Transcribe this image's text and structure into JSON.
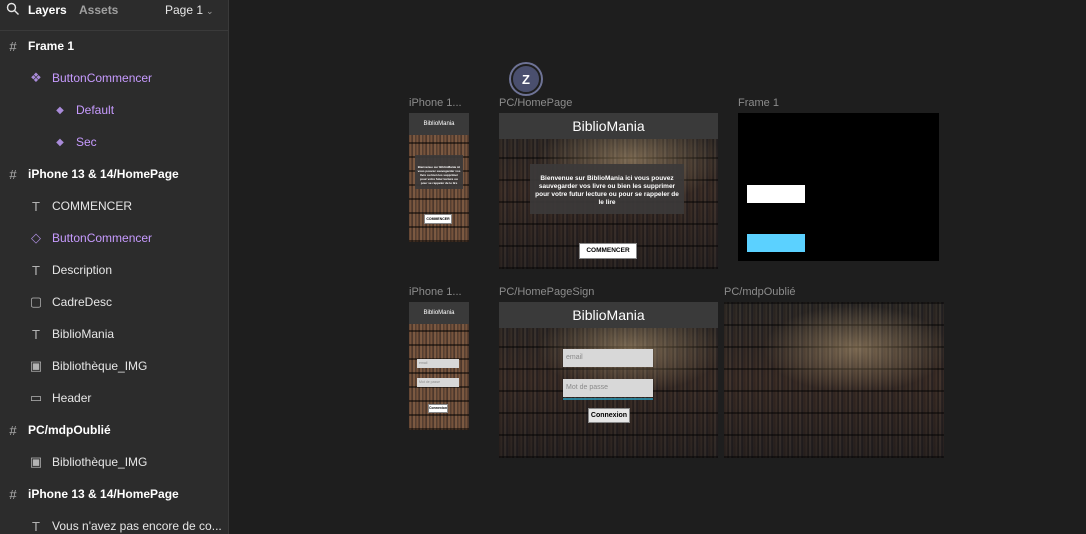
{
  "sidebar": {
    "tabs": {
      "layers": "Layers",
      "assets": "Assets"
    },
    "page": "Page 1",
    "layers": [
      {
        "label": "Frame 1",
        "icon": "frame-icon",
        "kind": "frame"
      },
      {
        "label": "ButtonCommencer",
        "icon": "component-icon",
        "kind": "purple"
      },
      {
        "label": "Default",
        "icon": "variant-icon",
        "kind": "purple"
      },
      {
        "label": "Sec",
        "icon": "variant-icon",
        "kind": "purple"
      },
      {
        "label": "iPhone 13 & 14/HomePage",
        "icon": "frame-icon",
        "kind": "frame"
      },
      {
        "label": "COMMENCER",
        "icon": "text-icon",
        "kind": "plain"
      },
      {
        "label": "ButtonCommencer",
        "icon": "instance-icon",
        "kind": "purple"
      },
      {
        "label": "Description",
        "icon": "text-icon",
        "kind": "plain"
      },
      {
        "label": "CadreDesc",
        "icon": "rectangle-icon",
        "kind": "plain"
      },
      {
        "label": "BiblioMania",
        "icon": "text-icon",
        "kind": "plain"
      },
      {
        "label": "Bibliothèque_IMG",
        "icon": "image-icon",
        "kind": "plain"
      },
      {
        "label": "Header",
        "icon": "header-rect-icon",
        "kind": "plain"
      },
      {
        "label": "PC/mdpOublié",
        "icon": "frame-icon",
        "kind": "frame"
      },
      {
        "label": "Bibliothèque_IMG",
        "icon": "image-icon",
        "kind": "plain"
      },
      {
        "label": "iPhone 13 & 14/HomePage",
        "icon": "frame-icon",
        "kind": "frame"
      },
      {
        "label": "Vous n'avez pas encore de co...",
        "icon": "text-icon",
        "kind": "plain"
      }
    ]
  },
  "canvas": {
    "avatar_letter": "Z",
    "frames": {
      "iphone_home": {
        "label": "iPhone 1...",
        "title": "BiblioMania",
        "desc": "Bienvenue sur BiblioMania ici vous pouvez sauvegarder vos livre ou bien les supprimer pour votre futur lecture ou pour se rappeler de le lire",
        "button": "COMMENCER"
      },
      "pc_home": {
        "label": "PC/HomePage",
        "title": "BiblioMania",
        "desc": "Bienvenue sur BiblioMania ici vous pouvez sauvegarder vos livre ou bien les supprimer pour votre futur lecture ou pour se rappeler de le lire",
        "button": "COMMENCER"
      },
      "frame1": {
        "label": "Frame 1"
      },
      "iphone_sign": {
        "label": "iPhone 1...",
        "title": "BiblioMania",
        "email": "email",
        "password": "Mot de passe",
        "button": "Connexion"
      },
      "pc_sign": {
        "label": "PC/HomePageSign",
        "title": "BiblioMania",
        "email": "email",
        "password": "Mot de passe",
        "button": "Connexion"
      },
      "pc_mdp": {
        "label": "PC/mdpOublié"
      }
    }
  },
  "colors": {
    "sidebar_bg": "#2c2c2c",
    "canvas_bg": "#1e1e1e",
    "component_purple": "#c79bff",
    "frame1_cyan": "#5bd1ff"
  }
}
